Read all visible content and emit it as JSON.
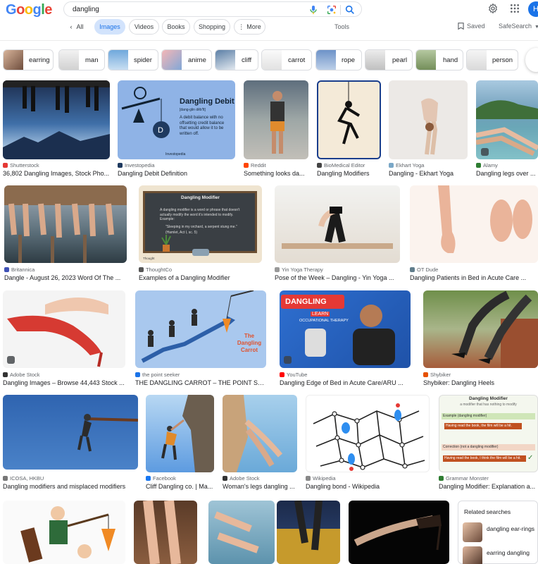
{
  "header": {
    "logo": [
      "G",
      "o",
      "o",
      "g",
      "l",
      "e"
    ],
    "logo_colors": [
      "#4285F4",
      "#EA4335",
      "#FBBC05",
      "#4285F4",
      "#34A853",
      "#EA4335"
    ],
    "search_value": "dangling",
    "avatar_letter": "H"
  },
  "tabs": {
    "all": "All",
    "images": "Images",
    "videos": "Videos",
    "books": "Books",
    "shopping": "Shopping",
    "more": "More",
    "tools": "Tools",
    "saved": "Saved",
    "safesearch": "SafeSearch"
  },
  "chips": [
    "earring",
    "man",
    "spider",
    "anime",
    "cliff",
    "carrot",
    "rope",
    "pearl",
    "hand",
    "person"
  ],
  "results": [
    {
      "source": "Shutterstock",
      "title": "36,802 Dangling Images, Stock Pho...",
      "fav": "#e53935"
    },
    {
      "source": "Investopedia",
      "title": "Dangling Debit Definition",
      "fav": "#1f3a5f"
    },
    {
      "source": "Reddit",
      "title": "Something looks da...",
      "fav": "#ff4500"
    },
    {
      "source": "BioMedical Editor",
      "title": "Dangling Modifiers",
      "fav": "#444"
    },
    {
      "source": "Ekhart Yoga",
      "title": "Dangling - Ekhart Yoga",
      "fav": "#7aa7c7"
    },
    {
      "source": "Alamy",
      "title": "Dangling legs over ...",
      "fav": "#2e7d32"
    },
    {
      "source": "Britannica",
      "title": "Dangle - August 26, 2023 Word Of The ...",
      "fav": "#3f51b5"
    },
    {
      "source": "ThoughtCo",
      "title": "Examples of a Dangling Modifier",
      "fav": "#555"
    },
    {
      "source": "Yin Yoga Therapy",
      "title": "Pose of the Week – Dangling - Yin Yoga ...",
      "fav": "#999"
    },
    {
      "source": "OT Dude",
      "title": "Dangling Patients in Bed in Acute Care ...",
      "fav": "#607d8b"
    },
    {
      "source": "Adobe Stock",
      "title": "Dangling Images – Browse 44,443 Stock ...",
      "fav": "#333"
    },
    {
      "source": "the point seeker",
      "title": "THE DANGLING CARROT – THE POINT SEEKER",
      "fav": "#1a73e8"
    },
    {
      "source": "YouTube",
      "title": "Dangling Edge of Bed in Acute Care/ARU ...",
      "fav": "#ff0000"
    },
    {
      "source": "Shybiker",
      "title": "Shybiker: Dangling Heels",
      "fav": "#e65100"
    },
    {
      "source": "ICOSA, HKBU",
      "title": "Dangling modifiers and misplaced modifiers",
      "fav": "#777"
    },
    {
      "source": "Facebook",
      "title": "Cliff Dangling co. | Ma...",
      "fav": "#1877f2"
    },
    {
      "source": "Adobe Stock",
      "title": "Woman's legs dangling ...",
      "fav": "#333"
    },
    {
      "source": "Wikipedia",
      "title": "Dangling bond - Wikipedia",
      "fav": "#888"
    },
    {
      "source": "Grammar Monster",
      "title": "Dangling Modifier: Explanation a...",
      "fav": "#2e7d32"
    }
  ],
  "investopedia_card": {
    "title": "Dangling Debit",
    "phonetic": "[dang-glin dĕb′ĭt]",
    "body": "A debit balance with no offsetting credit balance that would allow it to be written off.",
    "brand": "Investopedia"
  },
  "thoughtco_card": {
    "title": "Dangling Modifier",
    "body": "A dangling modifier is a word or phrase that doesn't actually modify the word it's intended to modify. Example:",
    "quote": "\"Sleeping in my orchard, a serpent stung me.\"",
    "cite": "(Hamlet, Act I, sc. 5)",
    "brand": "Thought"
  },
  "youtube_card": {
    "line1": "DANGLING",
    "line2": "LEARN",
    "line3": "OCCUPATIONAL THERAPY"
  },
  "carrot_card": {
    "text": "The Dangling Carrot"
  },
  "grammar_card": {
    "title": "Dangling Modifier",
    "subtitle": "a modifier that has nothing to modify",
    "ex_label": "Example (dangling modifier)",
    "ex_text": "Having read the book, the film will be a hit.",
    "corr_label": "Correction (not a dangling modifier)",
    "corr_text": "Having read the book, I think the film will be a hit."
  },
  "related": {
    "header": "Related searches",
    "items": [
      {
        "text": "dangling ear-rings",
        "bold": "ear-rings"
      },
      {
        "text": "earring dangling",
        "bold": "earring"
      }
    ]
  },
  "colors": {
    "accent": "#1a73e8",
    "active_tab_bg": "#d2e3fc"
  }
}
